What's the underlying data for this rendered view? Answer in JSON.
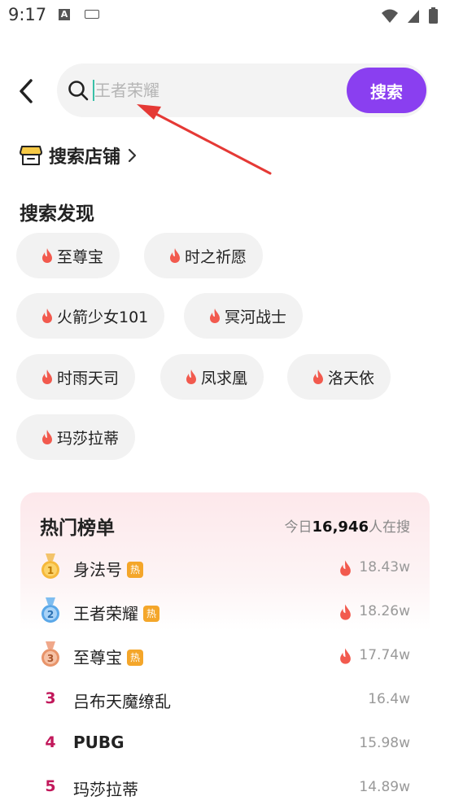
{
  "status_bar": {
    "time": "9:17"
  },
  "search": {
    "placeholder": "王者荣耀",
    "value": "",
    "button_label": "搜索"
  },
  "shop_link": {
    "label": "搜索店铺"
  },
  "discover": {
    "title": "搜索发现",
    "chips": [
      "至尊宝",
      "时之祈愿",
      "火箭少女101",
      "冥河战士",
      "时雨天司",
      "凤求凰",
      "洛天依",
      "玛莎拉蒂"
    ]
  },
  "hot_list": {
    "title": "热门榜单",
    "count_prefix": "今日",
    "count": "16,946",
    "count_suffix": "人在搜",
    "hot_badge": "热",
    "items": [
      {
        "rank": "1",
        "name": "身法号",
        "value": "18.43w",
        "medal": "gold",
        "hot": true
      },
      {
        "rank": "2",
        "name": "王者荣耀",
        "value": "18.26w",
        "medal": "silver",
        "hot": true
      },
      {
        "rank": "3",
        "name": "至尊宝",
        "value": "17.74w",
        "medal": "bronze",
        "hot": true
      },
      {
        "rank": "3",
        "name": "吕布天魔缭乱",
        "value": "16.4w",
        "medal": "",
        "hot": false
      },
      {
        "rank": "4",
        "name": "PUBG",
        "value": "15.98w",
        "medal": "",
        "hot": false
      },
      {
        "rank": "5",
        "name": "玛莎拉蒂",
        "value": "14.89w",
        "medal": "",
        "hot": false
      }
    ]
  },
  "colors": {
    "accent": "#8a3ff0",
    "flame": "#f25a4e",
    "rank_number": "#c2185b",
    "annotation_arrow": "#e53935",
    "medal_gold": "#f6b93b",
    "medal_silver": "#5aa7e8",
    "medal_bronze": "#e8946a"
  },
  "icons": {
    "back": "chevron-left-icon",
    "search": "search-icon",
    "shop": "store-icon",
    "chip": "flame-icon",
    "trend": "flame-icon"
  }
}
